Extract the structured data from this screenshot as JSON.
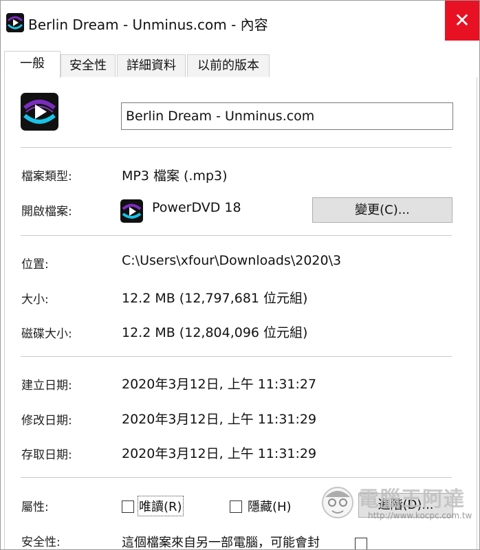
{
  "window": {
    "title": "Berlin Dream - Unminus.com - 內容",
    "close_symbol": "✕"
  },
  "tabs": [
    {
      "label": "一般",
      "active": true
    },
    {
      "label": "安全性",
      "active": false
    },
    {
      "label": "詳細資料",
      "active": false
    },
    {
      "label": "以前的版本",
      "active": false
    }
  ],
  "general": {
    "file_name": "Berlin Dream - Unminus.com",
    "type_label": "檔案類型:",
    "type_value": "MP3 檔案 (.mp3)",
    "opens_label": "開啟檔案:",
    "opens_value": "PowerDVD 18",
    "change_button": "變更(C)...",
    "location_label": "位置:",
    "location_value": "C:\\Users\\xfour\\Downloads\\2020\\3",
    "size_label": "大小:",
    "size_value": "12.2 MB (12,797,681 位元組)",
    "disk_size_label": "磁碟大小:",
    "disk_size_value": "12.2 MB (12,804,096 位元組)",
    "created_label": "建立日期:",
    "created_value": "2020年3月12日, 上午 11:31:27",
    "modified_label": "修改日期:",
    "modified_value": "2020年3月12日, 上午 11:31:29",
    "accessed_label": "存取日期:",
    "accessed_value": "2020年3月12日, 上午 11:31:29",
    "attributes_label": "屬性:",
    "readonly_label": "唯讀(R)",
    "hidden_label": "隱藏(H)",
    "advanced_button": "進階(D)...",
    "security_label": "安全性:",
    "security_text": "這個檔案來自另一部電腦，可能會封"
  },
  "watermark": {
    "text": "電腦王阿達",
    "url": "http://www.kocpc.com.tw"
  },
  "colors": {
    "close": "#e81123",
    "button_bg": "#e1e1e1",
    "icon_purple": "#7b2cbf",
    "icon_cyan": "#19c3e6"
  }
}
